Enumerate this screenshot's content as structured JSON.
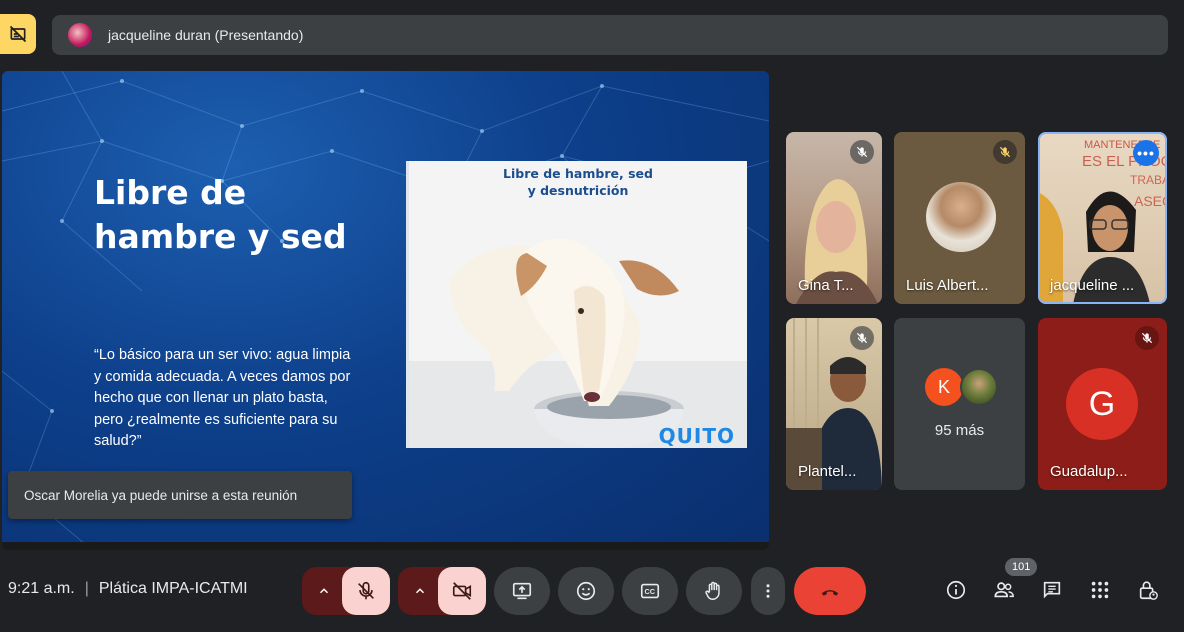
{
  "header": {
    "presenter_label": "jacqueline duran (Presentando)",
    "pin_icon": "pin-off-icon"
  },
  "slide": {
    "title": "Libre de hambre y sed",
    "quote": "“Lo básico para un ser vivo: agua limpia y comida adecuada. A veces damos por hecho que con llenar un plato basta, pero ¿realmente es suficiente para su salud?”",
    "image_caption_line1": "Libre de hambre, sed",
    "image_caption_line2": "y desnutrición",
    "image_logo": "QUITO"
  },
  "toast": {
    "message": "Oscar Morelia ya puede unirse a esta reunión"
  },
  "participants": [
    {
      "name": "Gina T...",
      "muted": true
    },
    {
      "name": "Luis Albert...",
      "muted": true
    },
    {
      "name": "jacqueline ...",
      "muted": false,
      "speaking": true
    },
    {
      "name": "Plantel...",
      "muted": true
    },
    {
      "name": "95 más",
      "avatar_letter": "K",
      "avatar_color": "#f4511e"
    },
    {
      "name": "Guadalup...",
      "muted": true,
      "avatar_letter": "G",
      "avatar_color": "#d93025"
    }
  ],
  "bottom_bar": {
    "time": "9:21 a.m.",
    "separator": "|",
    "meeting_name": "Plática IMPA-ICATMI",
    "people_count": "101"
  },
  "colors": {
    "background": "#202124",
    "surface": "#3c4043",
    "danger": "#ea4335",
    "accent": "#8ab4f8",
    "pin": "#fdd663"
  }
}
